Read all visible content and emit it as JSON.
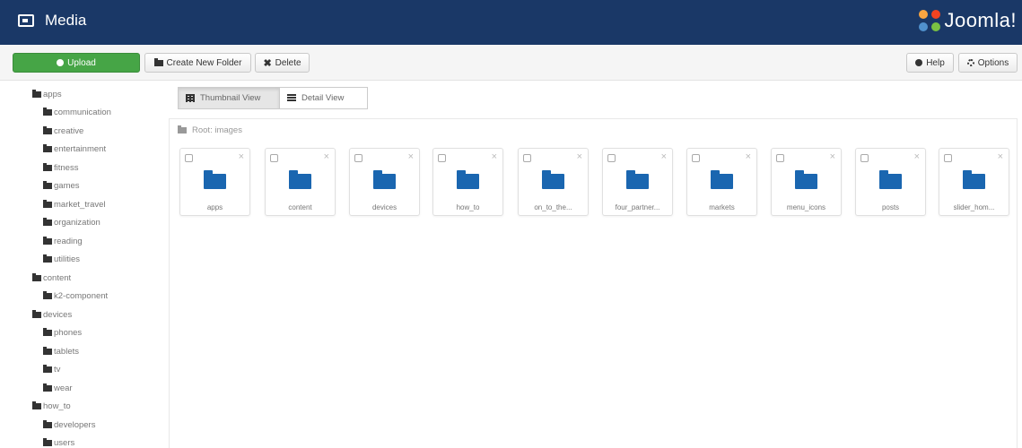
{
  "header": {
    "title": "Media",
    "logo_text": "Joomla!"
  },
  "toolbar": {
    "upload_label": "Upload",
    "create_folder_label": "Create New Folder",
    "delete_label": "Delete",
    "help_label": "Help",
    "options_label": "Options"
  },
  "tree": [
    {
      "label": "apps",
      "level": 0
    },
    {
      "label": "communication",
      "level": 1
    },
    {
      "label": "creative",
      "level": 1
    },
    {
      "label": "entertainment",
      "level": 1
    },
    {
      "label": "fitness",
      "level": 1
    },
    {
      "label": "games",
      "level": 1
    },
    {
      "label": "market_travel",
      "level": 1
    },
    {
      "label": "organization",
      "level": 1
    },
    {
      "label": "reading",
      "level": 1
    },
    {
      "label": "utilities",
      "level": 1
    },
    {
      "label": "content",
      "level": 0
    },
    {
      "label": "k2-component",
      "level": 1
    },
    {
      "label": "devices",
      "level": 0
    },
    {
      "label": "phones",
      "level": 1
    },
    {
      "label": "tablets",
      "level": 1
    },
    {
      "label": "tv",
      "level": 1
    },
    {
      "label": "wear",
      "level": 1
    },
    {
      "label": "how_to",
      "level": 0
    },
    {
      "label": "developers",
      "level": 1
    },
    {
      "label": "users",
      "level": 1
    }
  ],
  "view": {
    "thumbnail_label": "Thumbnail View",
    "detail_label": "Detail View"
  },
  "breadcrumb": "Root: images",
  "folders": [
    {
      "label": "apps"
    },
    {
      "label": "content"
    },
    {
      "label": "devices"
    },
    {
      "label": "how_to"
    },
    {
      "label": "on_to_the..."
    },
    {
      "label": "four_partner..."
    },
    {
      "label": "markets"
    },
    {
      "label": "menu_icons"
    },
    {
      "label": "posts"
    },
    {
      "label": "slider_hom..."
    }
  ],
  "colors": {
    "header_bg": "#1a3867",
    "upload_bg": "#46a546",
    "folder_blue": "#1a66b0"
  }
}
